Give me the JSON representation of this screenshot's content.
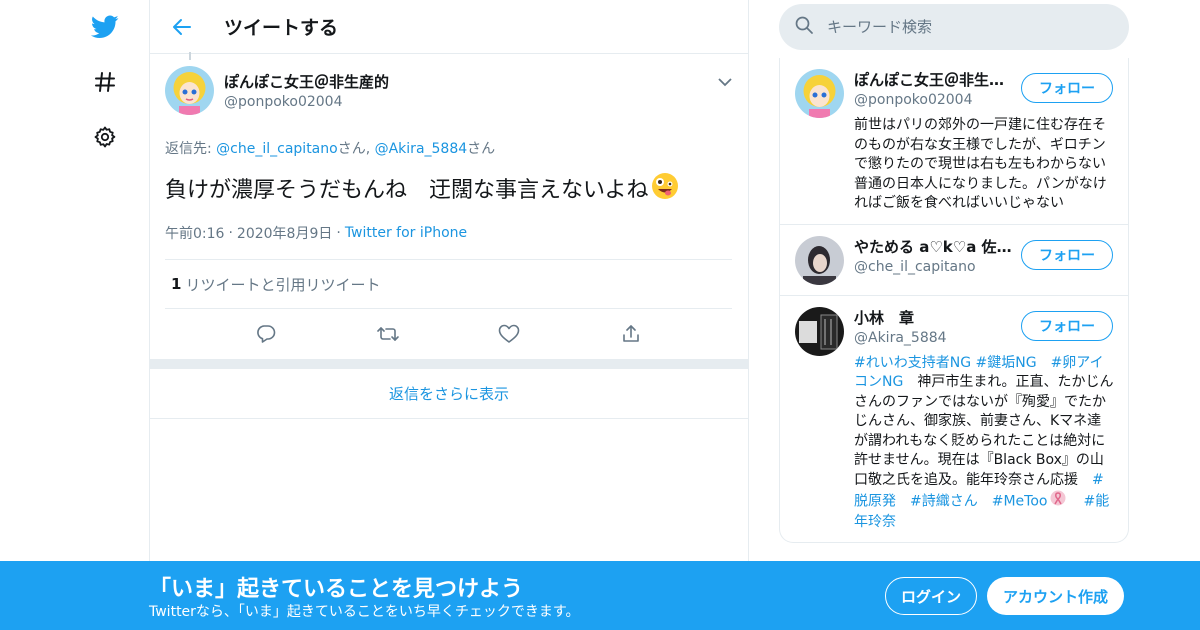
{
  "colors": {
    "accent": "#1da1f2",
    "link": "#1b95e0",
    "muted": "#657786",
    "border": "#e6ecf0"
  },
  "nav": {
    "icons": [
      "twitter-bird-icon",
      "hashtag-icon",
      "gear-icon"
    ]
  },
  "header": {
    "title": "ツイートする"
  },
  "tweet": {
    "author_name": "ぽんぽこ女王＠非生産的",
    "author_handle": "@ponpoko02004",
    "reply_prefix": "返信先: ",
    "reply_user1": "@che_il_capitano",
    "reply_san1": "さん, ",
    "reply_user2": "@Akira_5884",
    "reply_san2": "さん",
    "text": "負けが濃厚そうだもんね　迂闊な事言えないよね",
    "emoji": "zany-face-emoji",
    "time": "午前0:16",
    "dot": "·",
    "date": "2020年8月9日",
    "source": "Twitter for iPhone",
    "retweet_count": "1",
    "retweet_label": "リツイートと引用リツイート"
  },
  "more_replies": "返信をさらに表示",
  "search": {
    "placeholder": "キーワード検索"
  },
  "users": [
    {
      "name": "ぽんぽこ女王＠非生産的",
      "handle": "@ponpoko02004",
      "follow": "フォロー",
      "bio": "前世はパリの郊外の一戸建に住む存在そのものが右な女王様でしたが、ギロチンで懲りたので現世は右も左もわからない普通の日本人になりました。パンがなければご飯を食べればいいじゃない"
    },
    {
      "name": "やためる a♡k♡a 佐々木",
      "handle": "@che_il_capitano",
      "follow": "フォロー"
    },
    {
      "name": "小林　章",
      "handle": "@Akira_5884",
      "follow": "フォロー",
      "bio_tag1": "#れいわ支持者NG",
      "bio_tag2": "#鍵垢NG",
      "bio_tag3": "#卵アイコンNG",
      "bio_text": "　神戸市生まれ。正直、たかじんさんのファンではないが『殉愛』でたかじんさん、御家族、前妻さん、Kマネ達が謂われもなく貶められたことは絶対に許せません。現在は『Black Box』の山口敬之氏を追及。能年玲奈さん応援　",
      "bio_tag4": "#脱原発",
      "bio_tag5": "#詩織さん",
      "bio_tag6": "#MeToo",
      "bio_tag7": "#能年玲奈"
    }
  ],
  "banner": {
    "title": "「いま」起きていることを見つけよう",
    "subtitle": "Twitterなら、「いま」起きていることをいち早くチェックできます。",
    "login": "ログイン",
    "signup": "アカウント作成"
  }
}
